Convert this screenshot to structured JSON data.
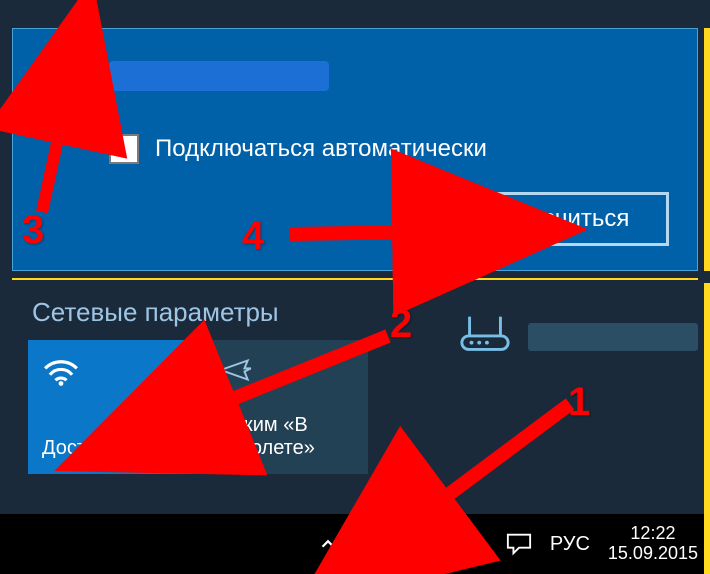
{
  "top": {
    "auto_connect_label": "Подключаться автоматически",
    "connect_button": "Подключиться"
  },
  "bottom": {
    "section_title": "Сетевые параметры",
    "tile_wifi_label": "Доступно",
    "tile_airplane_label": "Режим «В самолете»"
  },
  "taskbar": {
    "wifi_prefix": "*",
    "lang": "РУС",
    "time": "12:22",
    "date": "15.09.2015"
  },
  "annotations": {
    "num1": "1",
    "num2": "2",
    "num3": "3",
    "num4": "4"
  }
}
